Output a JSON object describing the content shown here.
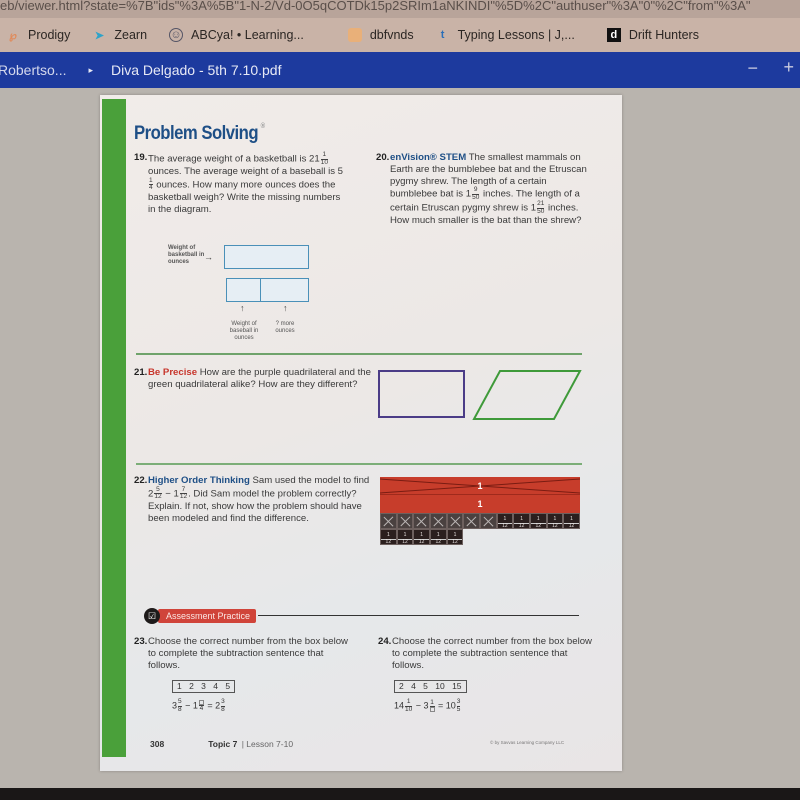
{
  "browser": {
    "url": "eb/viewer.html?state=%7B\"ids\"%3A%5B\"1-N-2/Vd-0O5qCOTDk15p2SRIm1aNKINDI\"%5D%2C\"authuser\"%3A\"0\"%2C\"from\"%3A\"",
    "bookmarks": [
      {
        "label": "Prodigy",
        "icon": "prodigy-icon"
      },
      {
        "label": "Zearn",
        "icon": "zearn-icon"
      },
      {
        "label": "ABCya! • Learning...",
        "icon": "abcya-icon"
      },
      {
        "label": "dbfvnds",
        "icon": "bookmark-icon"
      },
      {
        "label": "Typing Lessons | J,...",
        "icon": "typing-icon"
      },
      {
        "label": "Drift Hunters",
        "icon": "drift-hunters-icon"
      }
    ]
  },
  "viewer": {
    "breadcrumb_parent": "Robertso...",
    "breadcrumb_separator": "▸",
    "file_name": "Diva Delgado - 5th 7.10.pdf",
    "zoom_out_label": "−",
    "zoom_in_label": "+"
  },
  "page": {
    "section_title": "Problem Solving",
    "q19": {
      "number": "19.",
      "text_a": "The average weight of a basketball is 21",
      "frac_a": {
        "num": "1",
        "den": "10"
      },
      "text_b": " ounces. The average weight of a baseball is 5",
      "frac_b": {
        "num": "1",
        "den": "4"
      },
      "text_c": " ounces. How many more ounces does the basketball weigh? Write the missing numbers in the diagram.",
      "diagram": {
        "label_top": "Weight of basketball in ounces",
        "label_bottom_left": "Weight of baseball in ounces",
        "label_bottom_right": "? more ounces"
      }
    },
    "q20": {
      "number": "20.",
      "keyword": "enVision® STEM",
      "text_a": " The smallest mammals on Earth are the bumblebee bat and the Etruscan pygmy shrew. The length of a certain bumblebee bat is 1",
      "frac_a": {
        "num": "9",
        "den": "50"
      },
      "text_b": " inches. The length of a certain Etruscan pygmy shrew is 1",
      "frac_b": {
        "num": "21",
        "den": "50"
      },
      "text_c": " inches. How much smaller is the bat than the shrew?"
    },
    "q21": {
      "number": "21.",
      "keyword": "Be Precise",
      "text": " How are the purple quadrilateral and the green quadrilateral alike? How are they different?",
      "shape_colors": {
        "purple": "#4b3c87",
        "green": "#3f9a3a"
      }
    },
    "q22": {
      "number": "22.",
      "keyword": "Higher Order Thinking",
      "text_a": " Sam used the model to find 2",
      "frac_a": {
        "num": "5",
        "den": "12"
      },
      "text_b": " − 1",
      "frac_b": {
        "num": "7",
        "den": "12"
      },
      "text_c": ". Did Sam model the problem correctly? Explain. If not, show how the problem should have been modeled and find the difference.",
      "model": {
        "row1_label": "1",
        "row2_label": "1",
        "tile_label_num": "1",
        "tile_label_den": "12",
        "row3_crossed": 7,
        "row3_total": 12,
        "row4_total": 5
      }
    },
    "assessment_label": "Assessment Practice",
    "q23": {
      "number": "23.",
      "text": "Choose the correct number from the box below to complete the subtraction sentence that follows.",
      "choices": "1  2  3  4  5",
      "equation": {
        "w1": "3",
        "f1n": "5",
        "f1d": "8",
        "op": " − 1",
        "f2n": "",
        "f2d": "4",
        "eq": " = 2",
        "f3n": "3",
        "f3d": "8"
      }
    },
    "q24": {
      "number": "24.",
      "text": "Choose the correct number from the box below to complete the subtraction sentence that follows.",
      "choices": "2  4  5  10  15",
      "equation": {
        "w1": "14",
        "f1n": "1",
        "f1d": "10",
        "op": " − 3",
        "f2n": "1",
        "f2d": "",
        "eq": " = 10",
        "f3n": "3",
        "f3d": "5"
      }
    },
    "footer": {
      "page_number": "308",
      "topic": "Topic 7",
      "lesson": "| Lesson 7-10",
      "copyright": "© by Savvas Learning Company LLC"
    }
  }
}
